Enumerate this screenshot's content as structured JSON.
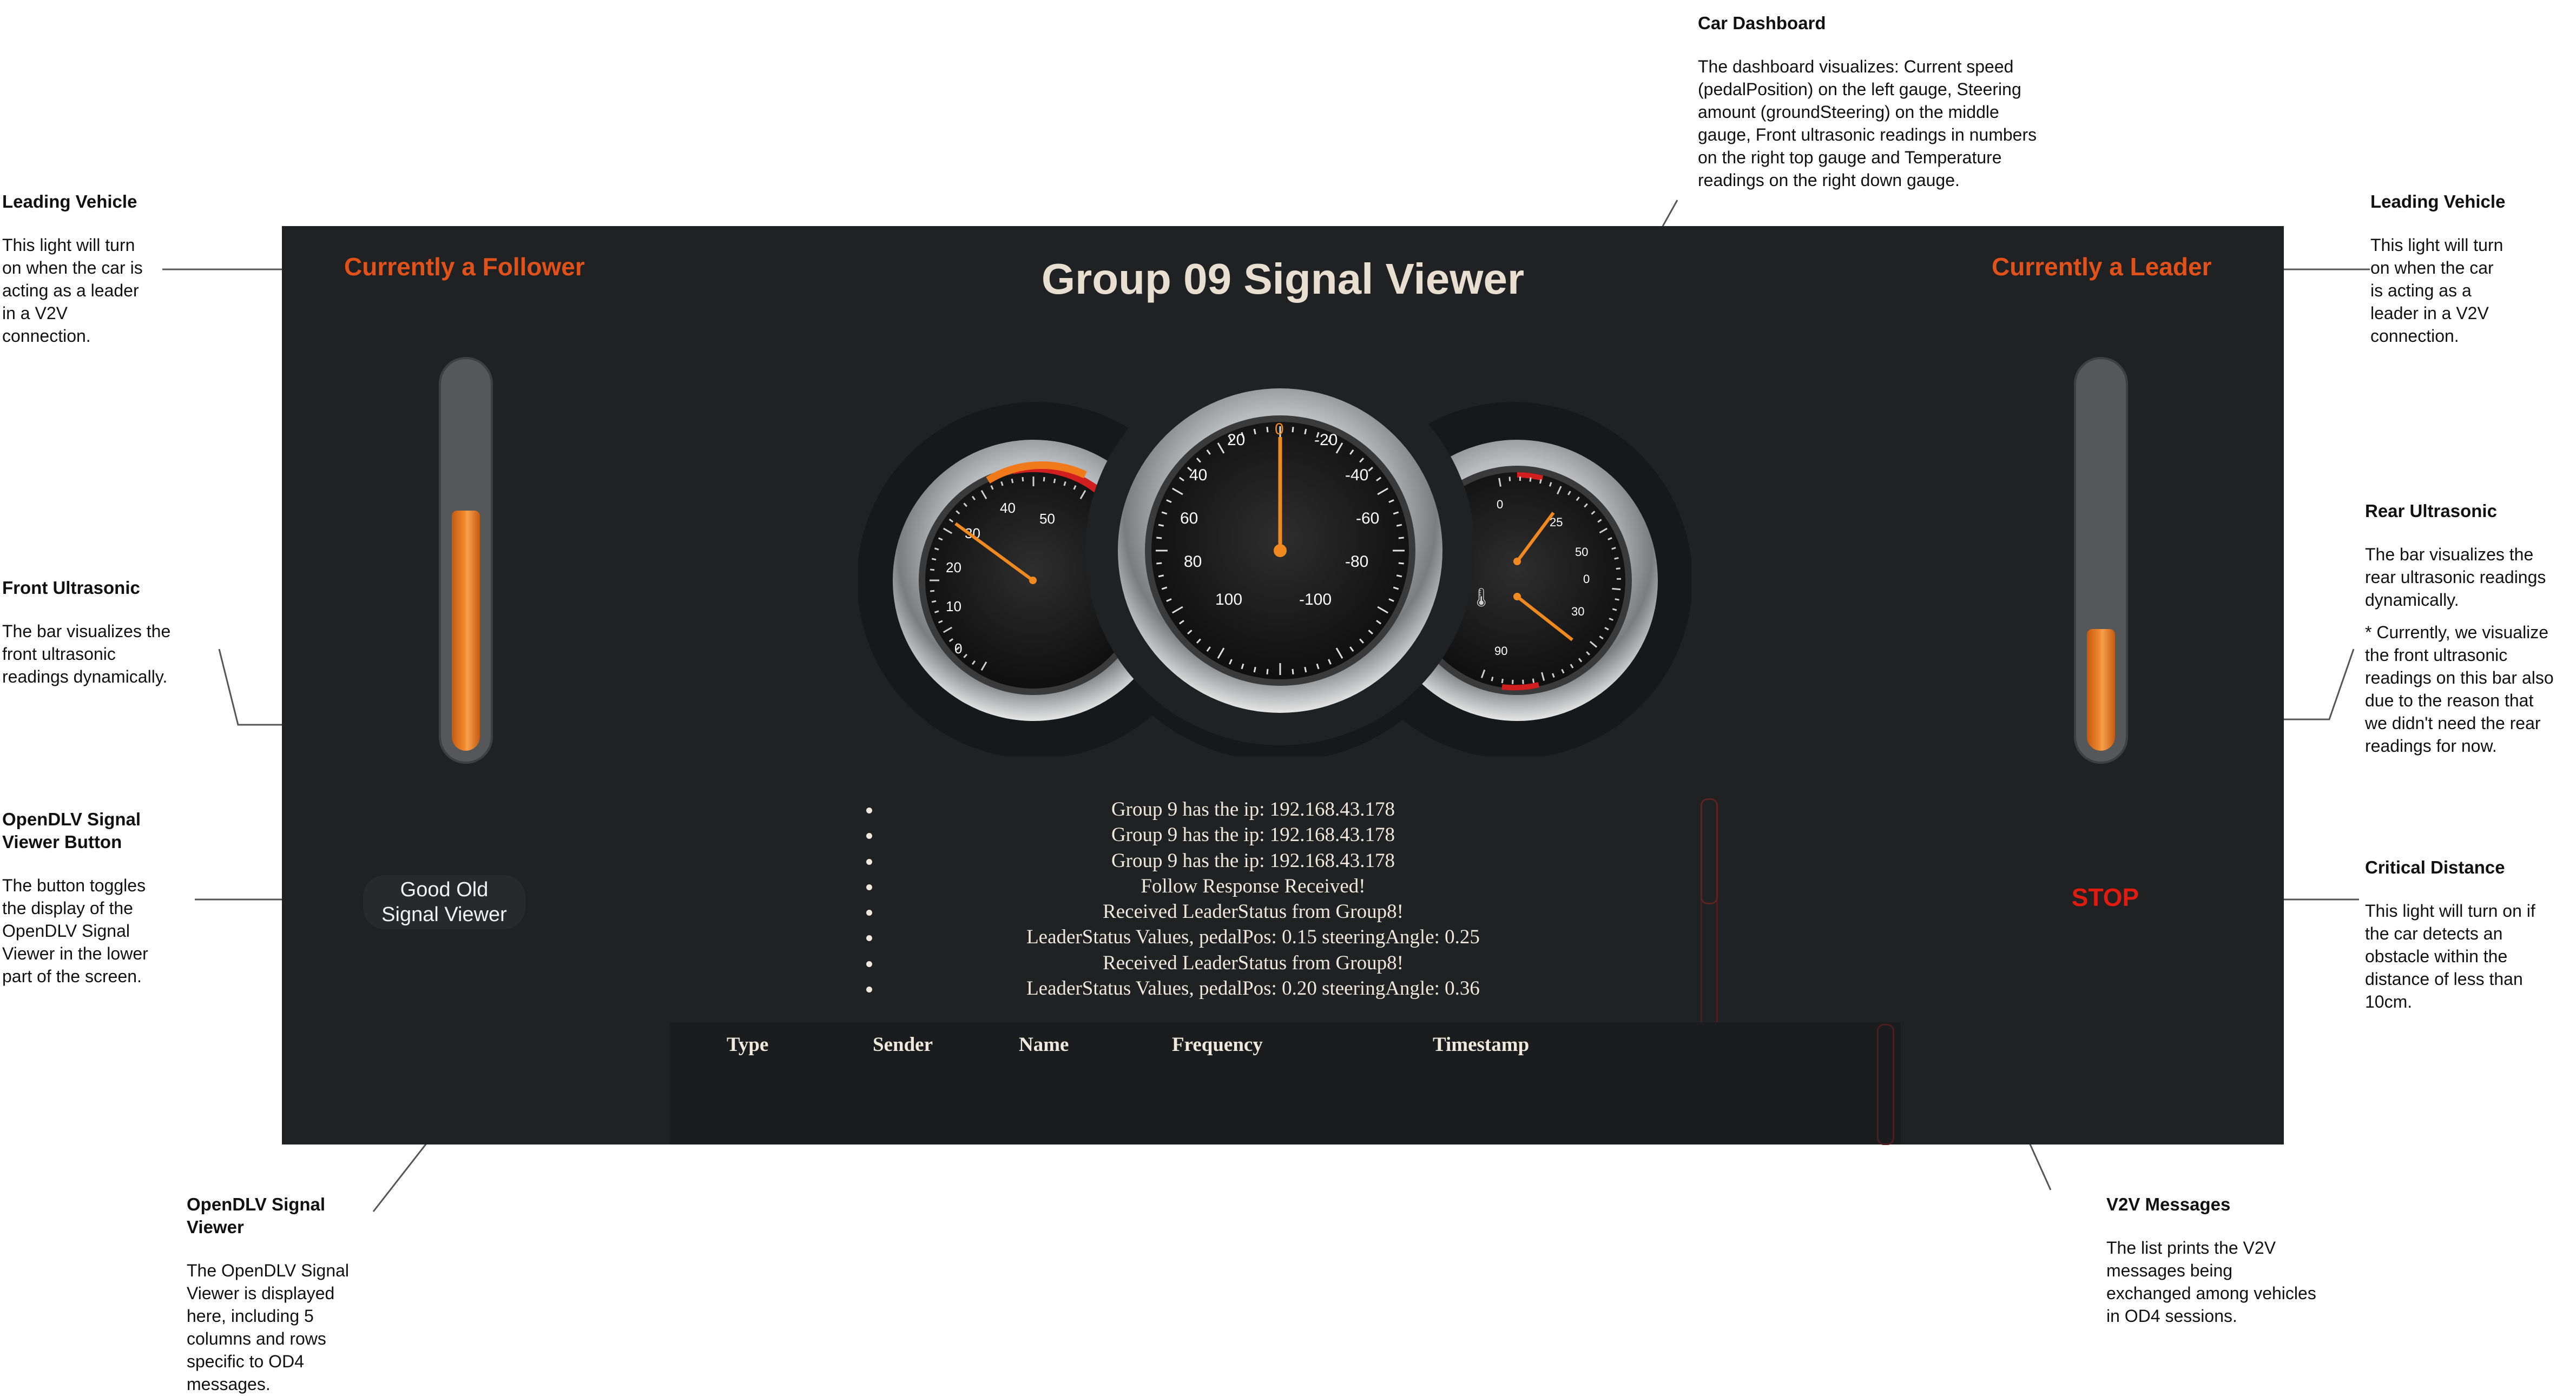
{
  "app": {
    "title": "Group 09 Signal Viewer",
    "follower_light": "Currently a Follower",
    "leader_light": "Currently a Leader",
    "toggle_button": [
      "Good Old",
      "Signal Viewer"
    ],
    "stop_light": "STOP",
    "front_bar_level": 0.63,
    "rear_bar_level": 0.32
  },
  "colors": {
    "panel": "#1f2123",
    "accent_orange": "#e1521b",
    "needle": "#f08a20",
    "stop_red": "#e01c10",
    "text_light": "#efe8dc"
  },
  "gauges": {
    "speed": {
      "ticks": [
        "0",
        "10",
        "20",
        "30",
        "40",
        "50"
      ]
    },
    "steering": {
      "ticks": [
        "0",
        "-20",
        "-40",
        "-60",
        "-80",
        "-100",
        "100",
        "80",
        "60",
        "40",
        "20"
      ]
    },
    "ultrasonic": {
      "ticks": [
        "0",
        "25",
        "50"
      ]
    },
    "temperature": {
      "ticks": [
        "0",
        "30",
        "90"
      ]
    }
  },
  "messages": [
    "Group 9 has the ip: 192.168.43.178",
    "Group 9 has the ip: 192.168.43.178",
    "Group 9 has the ip: 192.168.43.178",
    "Follow Response Received!",
    "Received LeaderStatus from Group8!",
    "LeaderStatus Values, pedalPos: 0.15 steeringAngle: 0.25",
    "Received LeaderStatus from Group8!",
    "LeaderStatus Values, pedalPos: 0.20 steeringAngle: 0.36"
  ],
  "signal_viewer": {
    "columns": [
      "Type",
      "Sender",
      "Name",
      "Frequency",
      "Timestamp"
    ]
  },
  "annotations": {
    "leading_vehicle_left": {
      "title": "Leading Vehicle",
      "lines": [
        "This light will turn",
        "on when the car is",
        "acting as a leader",
        "in a V2V",
        "connection."
      ]
    },
    "front_ultrasonic": {
      "title": "Front Ultrasonic",
      "lines": [
        "The bar visualizes the",
        "front ultrasonic",
        "readings dynamically."
      ]
    },
    "signal_viewer_button": {
      "title_lines": [
        "OpenDLV Signal",
        "Viewer Button"
      ],
      "lines": [
        "The button toggles",
        "the display of the",
        "OpenDLV Signal",
        "Viewer in the lower",
        "part of the screen."
      ]
    },
    "signal_viewer": {
      "title_lines": [
        "OpenDLV Signal",
        "Viewer"
      ],
      "lines": [
        "The OpenDLV Signal",
        "Viewer is displayed",
        "here, including 5",
        "columns and rows",
        "specific to OD4",
        "messages."
      ]
    },
    "car_dashboard": {
      "title": "Car Dashboard",
      "lines": [
        "The dashboard visualizes: Current speed",
        "(pedalPosition) on the left gauge, Steering",
        "amount (groundSteering) on the middle",
        "gauge, Front ultrasonic readings in numbers",
        "on the right top gauge and Temperature",
        "readings on the right down gauge."
      ]
    },
    "leading_vehicle_right": {
      "title": "Leading Vehicle",
      "lines": [
        "This light will turn",
        "on when the car",
        "is acting as a",
        "leader in a V2V",
        "connection."
      ]
    },
    "rear_ultrasonic": {
      "title": "Rear Ultrasonic",
      "lines": [
        "The bar visualizes the",
        "rear ultrasonic readings",
        "dynamically."
      ],
      "lines2": [
        "* Currently, we visualize",
        "the front ultrasonic",
        "readings on this bar also",
        "due to the reason that",
        "we didn't need the rear",
        "readings for now."
      ]
    },
    "critical_distance": {
      "title": "Critical Distance",
      "lines": [
        "This light will turn on if",
        "the car detects an",
        "obstacle within the",
        "distance of less than",
        "10cm."
      ]
    },
    "v2v_messages": {
      "title": "V2V Messages",
      "lines": [
        "The list prints the V2V",
        "messages being",
        "exchanged among vehicles",
        "in OD4 sessions."
      ]
    }
  }
}
